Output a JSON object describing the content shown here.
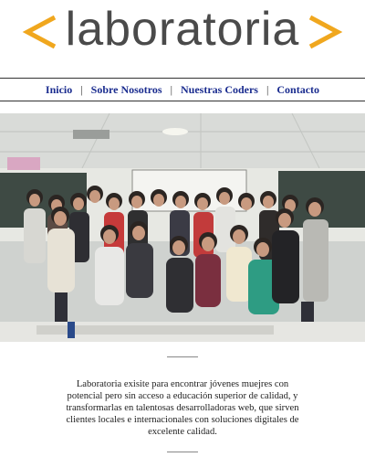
{
  "brand": {
    "logo_text": "laboratoria",
    "accent_color": "#f0a71e",
    "text_color": "#4a4a4a"
  },
  "nav": {
    "items": [
      {
        "label": "Inicio"
      },
      {
        "label": "Sobre Nosotros"
      },
      {
        "label": "Nuestras Coders"
      },
      {
        "label": "Contacto"
      }
    ],
    "separator": "|",
    "link_color": "#1a2c8f"
  },
  "hero": {
    "image": "group-photo"
  },
  "about": {
    "text": "Laboratoria exisite para encontrar jóvenes muejres con potencial pero sin acceso a educación superior de calidad, y transformarlas en talentosas desarrolladoras web, que sirven clientes locales e internacionales con soluciones digitales de excelente calidad."
  }
}
